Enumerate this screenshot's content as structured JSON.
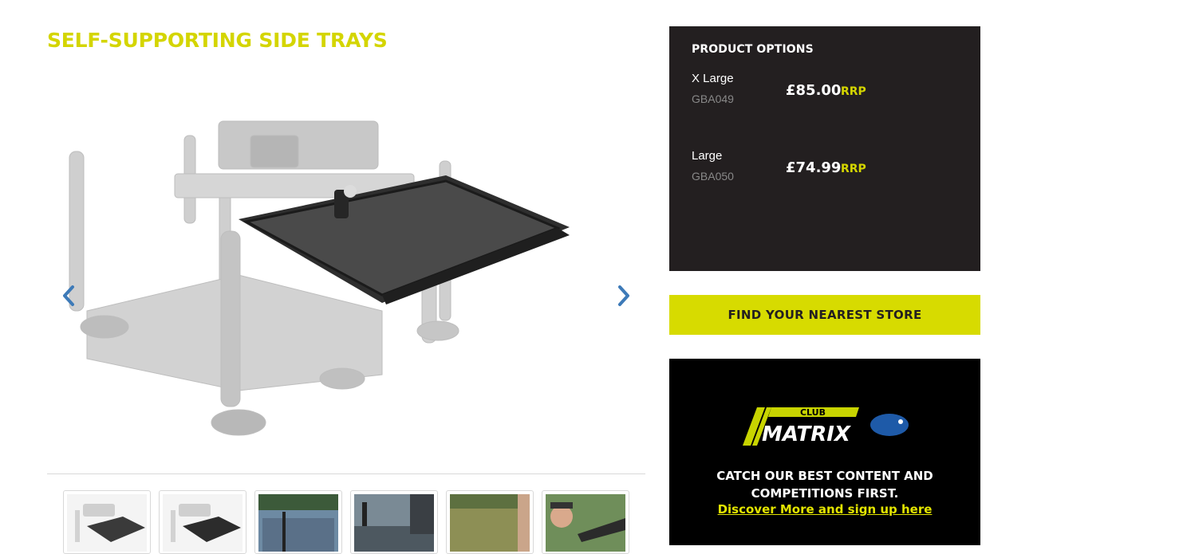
{
  "product": {
    "title": "SELF-SUPPORTING SIDE TRAYS"
  },
  "gallery": {
    "prev_icon": "chevron-left-icon",
    "next_icon": "chevron-right-icon",
    "thumbnails": [
      {
        "subject": "tray-on-box"
      },
      {
        "subject": "tray-on-box"
      },
      {
        "subject": "lake-seatbox"
      },
      {
        "subject": "angler-at-tray"
      },
      {
        "subject": "lake-view"
      },
      {
        "subject": "angler-portrait"
      }
    ]
  },
  "options": {
    "heading": "PRODUCT OPTIONS",
    "items": [
      {
        "name": "X Large",
        "sku": "GBA049",
        "price": "£85.00",
        "rrp": "RRP"
      },
      {
        "name": "Large",
        "sku": "GBA050",
        "price": "£74.99",
        "rrp": "RRP"
      }
    ]
  },
  "store": {
    "button_label": "FIND YOUR NEAREST STORE"
  },
  "club": {
    "logo_text_top": "CLUB",
    "logo_text_main": "MATRIX",
    "tagline_line1": "CATCH OUR BEST CONTENT AND",
    "tagline_line2": "COMPETITIONS FIRST.",
    "link_text": "Discover More and sign up here"
  },
  "colors": {
    "accent": "#d7db00",
    "panel": "#231f20",
    "arrow": "#3d7ab8"
  }
}
